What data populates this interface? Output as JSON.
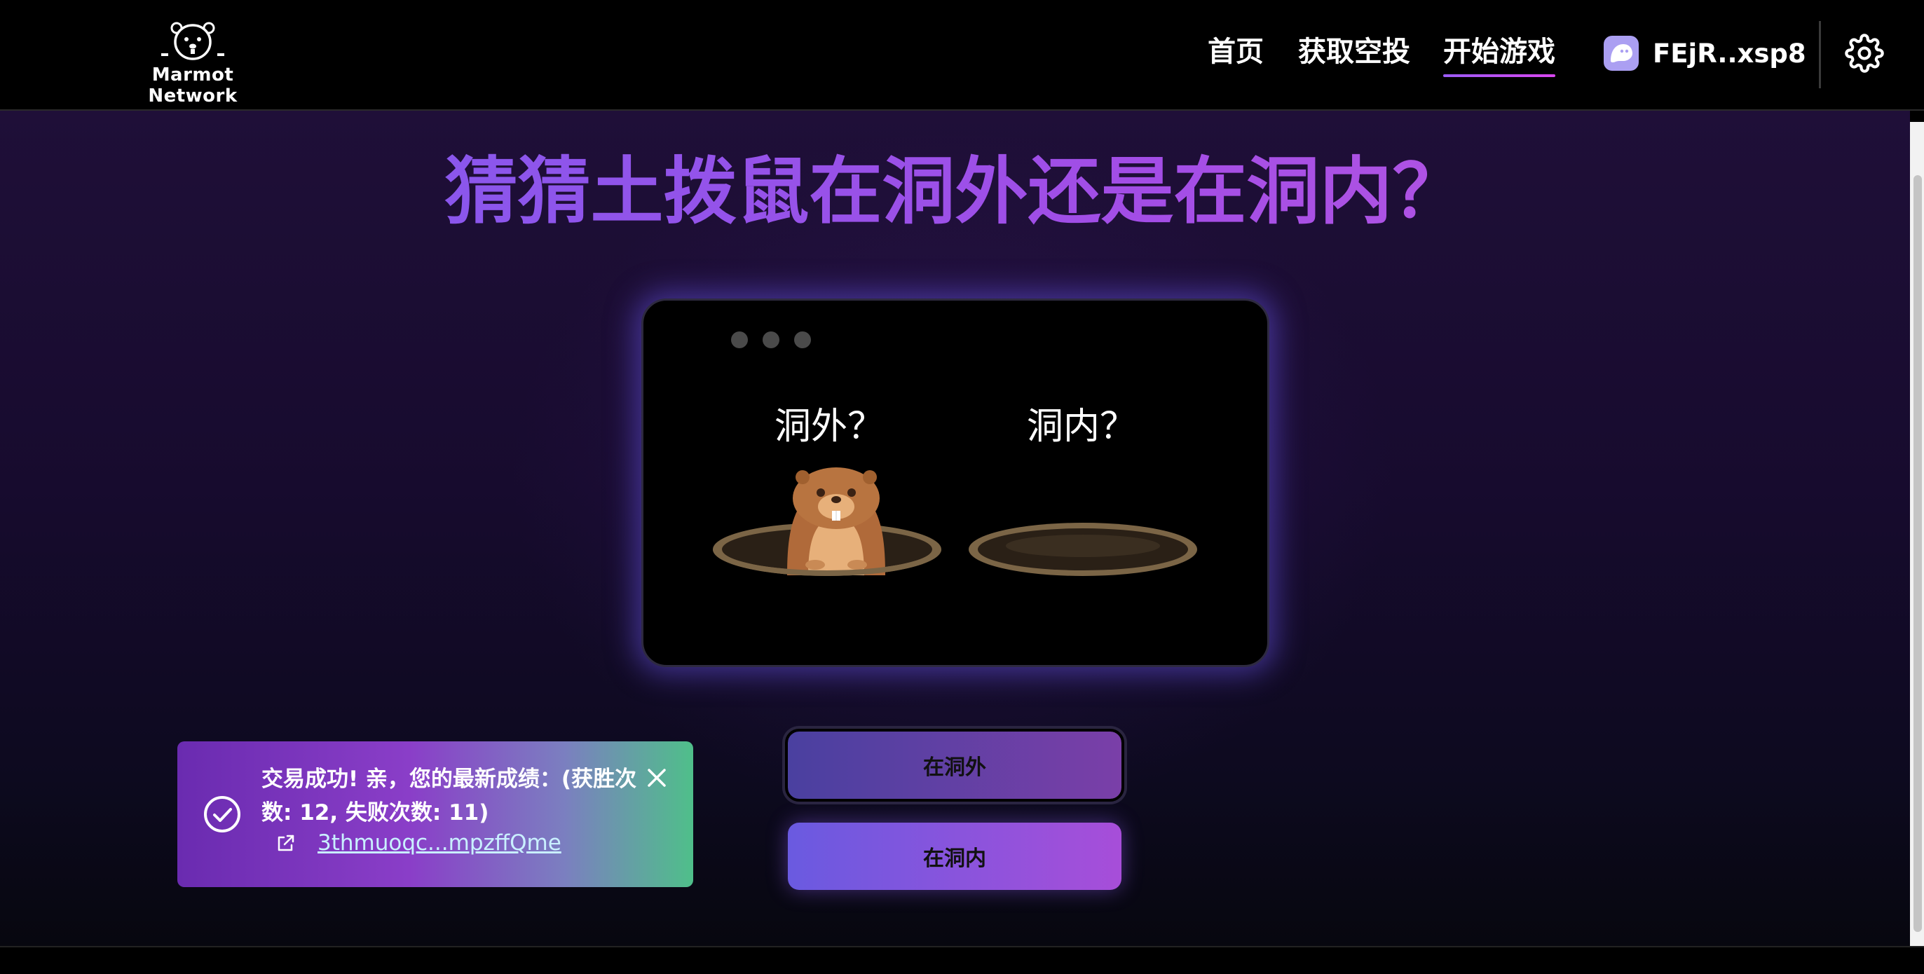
{
  "header": {
    "logo_text": "Marmot Network",
    "nav": [
      {
        "label": "首页"
      },
      {
        "label": "获取空投"
      },
      {
        "label": "开始游戏"
      }
    ],
    "wallet_address": "FEjR..xsp8",
    "wallet_icon": "ghost-icon",
    "settings_icon": "gear-icon"
  },
  "main": {
    "title": "猜猜土拨鼠在洞外还是在洞内？",
    "game": {
      "outside_label": "洞外？",
      "inside_label": "洞内？"
    },
    "buttons": {
      "outside": "在洞外",
      "inside": "在洞内"
    }
  },
  "toast": {
    "message": "交易成功! 亲，您的最新成绩：(获胜次数: 12, 失败次数: 11)",
    "link_text": "3thmuoqc...mpzffQme",
    "check_icon": "check-circle-icon",
    "close_icon": "close-icon",
    "link_icon": "external-link-icon"
  },
  "colors": {
    "accent": "#a34de6",
    "toast_green": "#4fbf8a",
    "nav_underline": "#d946ef"
  }
}
